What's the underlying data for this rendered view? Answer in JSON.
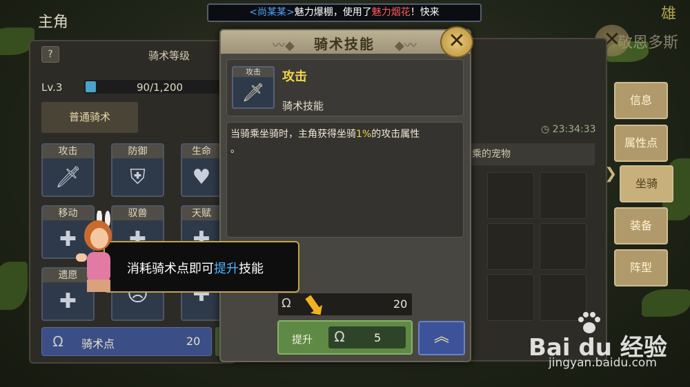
{
  "announcement": {
    "prefix": "<尚某某>",
    "mid": "魅力爆棚，使用了",
    "item": "魅力烟花",
    "suffix": "！快来"
  },
  "screen_title": "主角",
  "right_header": "敬恩多斯",
  "right_header_top": "雄",
  "left_panel": {
    "help": "?",
    "title": "骑术等级",
    "level": "Lv.3",
    "xp_text": "90/1,200",
    "xp_fraction": 0.075,
    "tab_normal": "普通骑术",
    "skills": [
      {
        "label": "攻击",
        "icon": "sword-icon"
      },
      {
        "label": "防御",
        "icon": "shield-icon"
      },
      {
        "label": "生命",
        "icon": "heart-plus-icon"
      },
      {
        "label": "移动",
        "icon": "boot-icon"
      },
      {
        "label": "驭兽",
        "icon": "beast-icon"
      },
      {
        "label": "天赋",
        "icon": "talent-icon"
      },
      {
        "label": "遗愿",
        "icon": "wish-icon"
      }
    ],
    "points_label": "骑术点",
    "points_value": "20"
  },
  "right_panel": {
    "timer": "23:34:33",
    "ride_pet": "乘的宠物",
    "side_tabs": [
      "信息",
      "属性点",
      "坐骑",
      "装备",
      "阵型"
    ],
    "active_tab": "坐骑"
  },
  "dialog": {
    "title": "骑术技能",
    "skill_badge": "攻击",
    "skill_name": "攻击",
    "skill_type": "骑术技能",
    "desc_pre": "当骑乘坐骑时，主角获得坐骑",
    "desc_hl": "1%",
    "desc_post": "的攻击属性",
    "desc_line2": "。",
    "cost_value": "20",
    "upgrade_label": "提升",
    "upgrade_value": "5"
  },
  "tutorial": {
    "pre": "消耗骑术点即可",
    "hl": "提升",
    "post": "技能"
  },
  "watermark": {
    "logo": "Bai du 经验",
    "url": "jingyan.baidu.com"
  },
  "colors": {
    "highlight_yellow": "#f2d64a",
    "highlight_blue": "#4fb4ff",
    "upgrade_green": "#5f8a45",
    "max_blue": "#3d5399"
  }
}
